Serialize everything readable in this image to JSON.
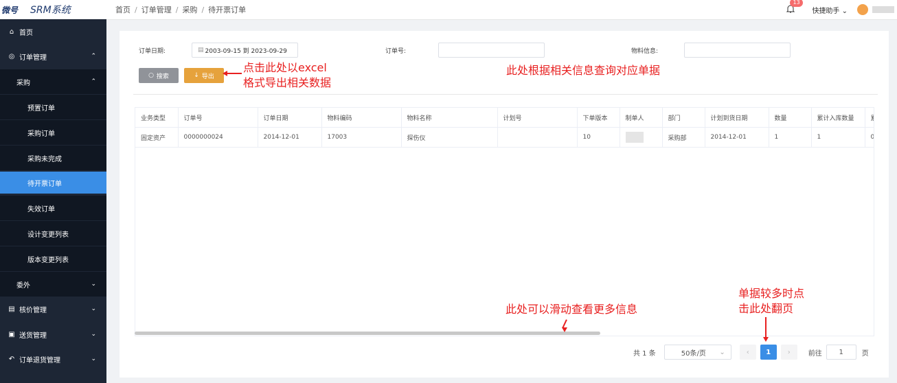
{
  "header": {
    "logo_mark": "微号",
    "app_name": "SRM系统",
    "breadcrumb": [
      "首页",
      "订单管理",
      "采购",
      "待开票订单"
    ],
    "notifications_count": "13",
    "helper_label": "快捷助手",
    "bell_icon": "bell-icon",
    "chevron_icon": "chevron-down-icon"
  },
  "sidebar": {
    "items": [
      {
        "label": "首页",
        "icon": "home-icon"
      },
      {
        "label": "订单管理",
        "icon": "check-circle-icon",
        "arrow": "^"
      },
      {
        "label": "采购",
        "arrow": "^"
      },
      {
        "label": "预置订单"
      },
      {
        "label": "采购订单"
      },
      {
        "label": "采购未完成"
      },
      {
        "label": "待开票订单"
      },
      {
        "label": "失效订单"
      },
      {
        "label": "设计变更列表"
      },
      {
        "label": "版本变更列表"
      },
      {
        "label": "委外",
        "arrow": "v"
      },
      {
        "label": "核价管理",
        "icon": "clipboard-icon",
        "arrow": "v"
      },
      {
        "label": "送货管理",
        "icon": "package-icon",
        "arrow": "v"
      },
      {
        "label": "订单退货管理",
        "icon": "return-icon",
        "arrow": "v"
      }
    ]
  },
  "filters": {
    "order_date_label": "订单日期:",
    "date_range": "2003-09-15  到  2023-09-29",
    "order_no_label": "订单号:",
    "order_no_value": "",
    "material_label": "物料信息:",
    "material_value": ""
  },
  "buttons": {
    "search": "搜索",
    "export": "导出"
  },
  "table": {
    "columns": [
      "业务类型",
      "订单号",
      "订单日期",
      "物料编码",
      "物料名称",
      "计划号",
      "下单版本",
      "制单人",
      "部门",
      "计划到货日期",
      "数量",
      "累计入库数量",
      "累"
    ],
    "rows": [
      [
        "固定资产",
        "0000000024",
        "2014-12-01",
        "17003",
        "探伤仪",
        "",
        "10",
        "",
        "采购部",
        "2014-12-01",
        "1",
        "1",
        "0"
      ]
    ]
  },
  "pagination": {
    "total": "共 1 条",
    "page_size": "50条/页",
    "current_page": "1",
    "goto_label": "前往",
    "goto_value": "1",
    "page_unit": "页"
  },
  "annotations": {
    "export_note_line1": "点击此处以excel",
    "export_note_line2": "格式导出相关数据",
    "query_note": "此处根据相关信息查询对应单据",
    "scroll_note": "此处可以滑动查看更多信息",
    "page_note_line1": "单据较多时点",
    "page_note_line2": "击此处翻页"
  },
  "colors": {
    "sidebar_bg": "#1d2635",
    "active_item": "#3a8ee6",
    "export_button": "#e6a23c",
    "search_button": "#909399",
    "annotation_red": "#e82020"
  }
}
